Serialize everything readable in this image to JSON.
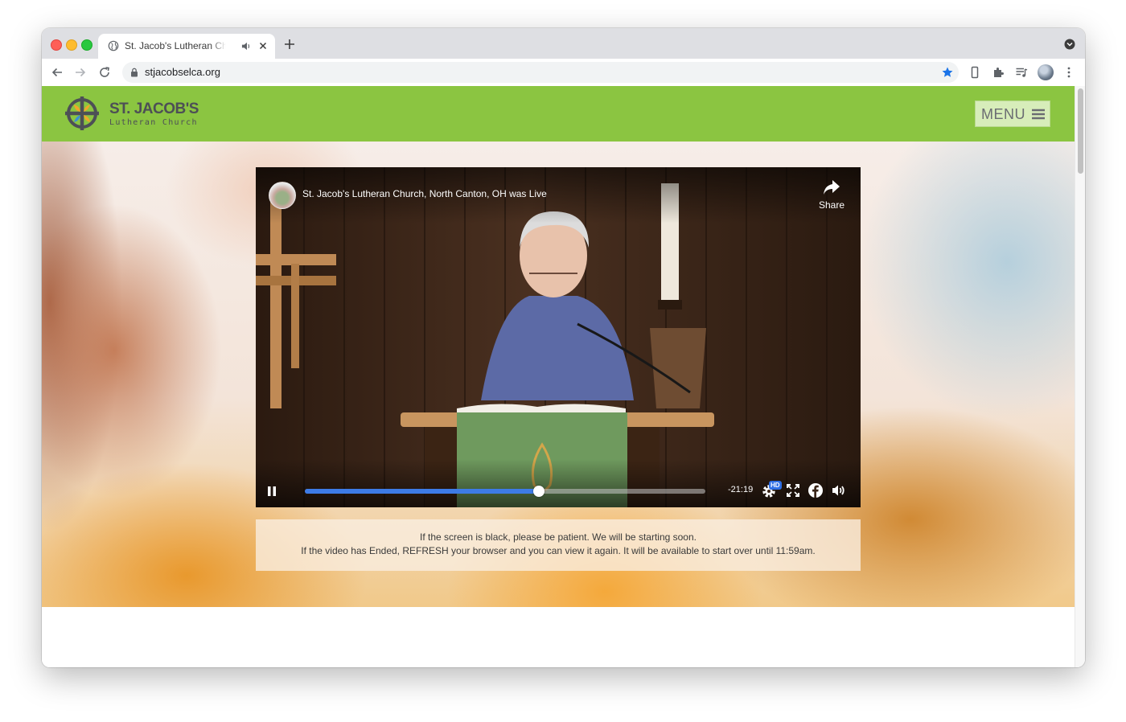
{
  "browser": {
    "tab_title": "St. Jacob's Lutheran Church",
    "url": "stjacobselca.org"
  },
  "site": {
    "logo_name": "ST. JACOB'S",
    "logo_sub": "Lutheran Church",
    "menu_label": "MENU",
    "brand_green": "#8bc541"
  },
  "video": {
    "title": "St. Jacob's Lutheran Church, North Canton, OH was Live",
    "share_label": "Share",
    "time_remaining": "-21:19",
    "hd_label": "HD",
    "progress": 0.585
  },
  "notice": {
    "line1": "If the screen is black, please be patient. We will be starting soon.",
    "line2": "If the video has Ended, REFRESH your browser and you can view it again. It will be available to start over until 11:59am."
  },
  "icons": {
    "favicon": "globe-icon",
    "audio": "speaker-icon",
    "close": "close-icon",
    "new_tab": "plus-icon",
    "back": "back-arrow-icon",
    "forward": "forward-arrow-icon",
    "reload": "reload-icon",
    "lock": "lock-icon",
    "bookmark": "star-icon",
    "extensions": "puzzle-icon",
    "media": "media-queue-icon",
    "more": "kebab-icon"
  }
}
